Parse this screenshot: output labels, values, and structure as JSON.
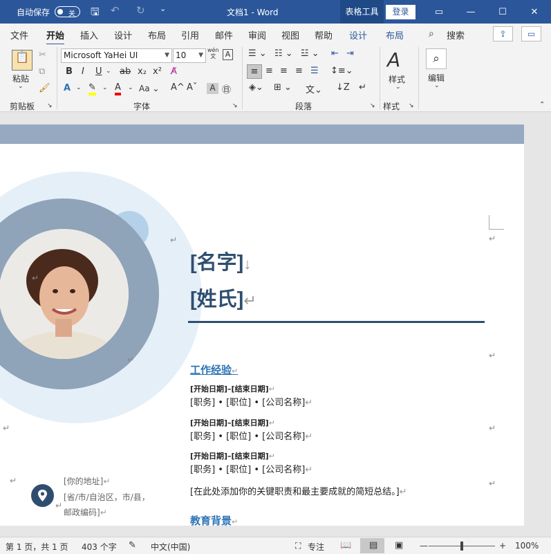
{
  "titlebar": {
    "autosave_label": "自动保存",
    "autosave_state": "关",
    "doc_title": "文档1  -  Word",
    "table_tools": "表格工具",
    "login": "登录"
  },
  "tabs": [
    "文件",
    "开始",
    "插入",
    "设计",
    "布局",
    "引用",
    "邮件",
    "审阅",
    "视图",
    "帮助",
    "设计",
    "布局"
  ],
  "search_label": "搜索",
  "ribbon": {
    "paste_label": "粘贴",
    "clipboard_group": "剪贴板",
    "font_name": "Microsoft YaHei UI",
    "font_size": "10",
    "font_group": "字体",
    "paragraph_group": "段落",
    "styles_label": "样式",
    "styles_group": "样式",
    "editing_label": "编辑"
  },
  "doc": {
    "name_first": "[名字]",
    "name_last": "[姓氏]",
    "section_work": "工作经验",
    "jobs": [
      {
        "dates": "[开始日期]–[结束日期]",
        "line": "[职务] • [职位] • [公司名称]"
      },
      {
        "dates": "[开始日期]–[结束日期]",
        "line": "[职务] • [职位] • [公司名称]"
      },
      {
        "dates": "[开始日期]–[结束日期]",
        "line": "[职务] • [职位] • [公司名称]"
      }
    ],
    "summary": "[在此处添加你的关键职责和最主要成就的简短总结。]",
    "section_edu": "教育背景",
    "address_line1": "[你的地址]",
    "address_line2": "[省/市/自治区，市/县，",
    "address_line3": "邮政编码]"
  },
  "status": {
    "page": "第 1 页，共 1 页",
    "words": "403 个字",
    "lang": "中文(中国)",
    "focus": "专注",
    "zoom": "100%"
  },
  "colors": {
    "title_bar": "#2b579a",
    "name_color": "#2f4e6f",
    "heading_color": "#2e74b5",
    "band": "#96a9c0"
  }
}
